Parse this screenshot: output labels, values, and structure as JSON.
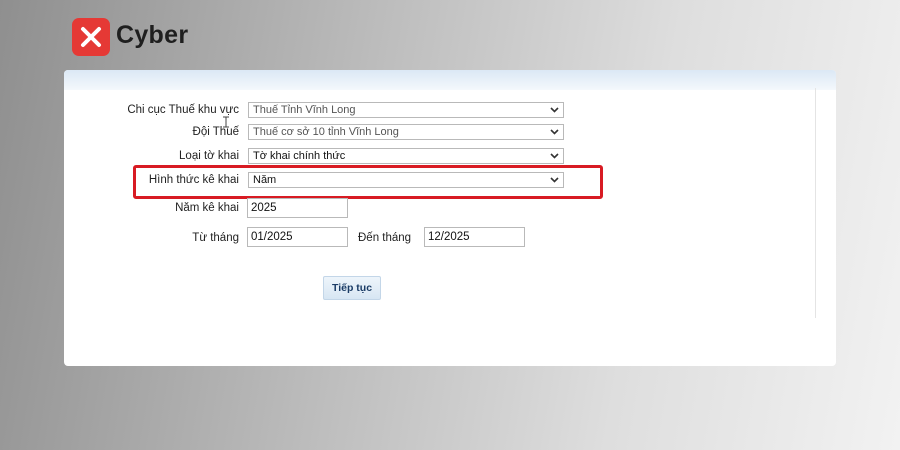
{
  "brand": {
    "name": "Cyber",
    "accent": "#e53935"
  },
  "form": {
    "chi_cuc": {
      "label": "Chi cục Thuế khu vực",
      "value": "Thuế Tỉnh Vĩnh Long"
    },
    "doi_thue": {
      "label": "Đội Thuế",
      "value": "Thuế cơ sở 10 tỉnh Vĩnh Long"
    },
    "loai_to_khai": {
      "label": "Loại tờ khai",
      "value": "Tờ khai chính thức"
    },
    "hinh_thuc": {
      "label": "Hình thức kê khai",
      "value": "Năm"
    },
    "nam_ke_khai": {
      "label": "Năm kê khai",
      "value": "2025"
    },
    "tu_thang": {
      "label": "Từ tháng",
      "value": "01/2025"
    },
    "den_thang": {
      "label": "Đến tháng",
      "value": "12/2025"
    },
    "submit_label": "Tiếp tục"
  },
  "highlight_color": "#d81b23"
}
